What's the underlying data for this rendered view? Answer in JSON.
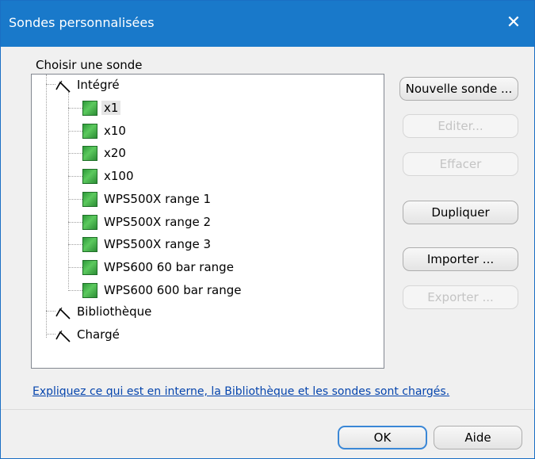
{
  "window": {
    "title": "Sondes personnalisées",
    "close_label": "✕"
  },
  "tree": {
    "group_label": "Choisir une sonde",
    "root_integrated": "Intégré",
    "items": [
      "x1",
      "x10",
      "x20",
      "x100",
      "WPS500X range 1",
      "WPS500X range 2",
      "WPS500X range 3",
      "WPS600 60 bar range",
      "WPS600 600 bar range"
    ],
    "selected_item": "x1",
    "root_library": "Bibliothèque",
    "root_loaded": "Chargé"
  },
  "buttons": {
    "new_probe": "Nouvelle sonde ...",
    "edit": "Editer...",
    "delete": "Effacer",
    "duplicate": "Dupliquer",
    "import": "Importer ...",
    "export": "Exporter ...",
    "ok": "OK",
    "help": "Aide"
  },
  "help_link": "Expliquez ce qui est en interne, la Bibliothèque et les sondes sont chargés.",
  "colors": {
    "titlebar": "#1979ca",
    "probe_green": "#3fb048",
    "link": "#0645ad"
  },
  "icons": {
    "probe_group": "probe-cable-icon",
    "probe_item": "probe-green-square-icon"
  }
}
